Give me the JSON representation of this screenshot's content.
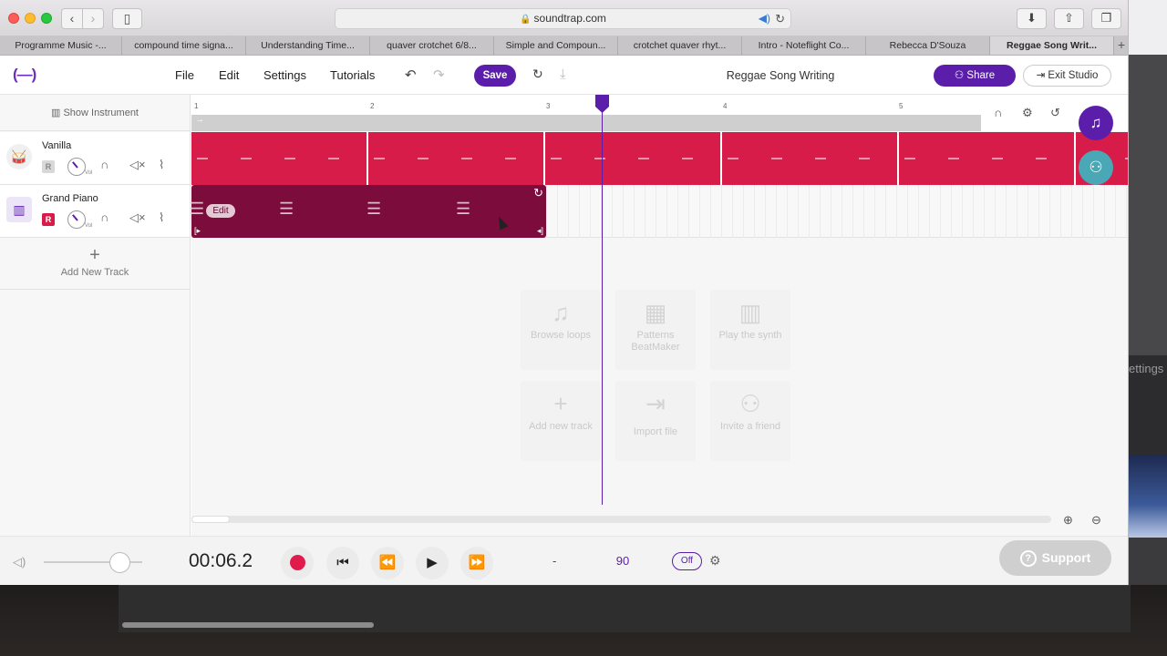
{
  "browser": {
    "address": "soundtrap.com",
    "tabs": [
      {
        "label": "Programme Music -...",
        "width": 134
      },
      {
        "label": "compound time signa...",
        "width": 136
      },
      {
        "label": "Understanding Time...",
        "width": 136
      },
      {
        "label": "quaver crotchet 6/8...",
        "width": 136
      },
      {
        "label": "Simple and Compoun...",
        "width": 136
      },
      {
        "label": "crotchet quaver rhyt...",
        "width": 136
      },
      {
        "label": "Intro - Noteflight Co...",
        "width": 136
      },
      {
        "label": "Rebecca D'Souza",
        "width": 136
      },
      {
        "label": "Reggae Song Writ...",
        "width": 136,
        "active": true
      }
    ]
  },
  "appbar": {
    "logo": "(—)",
    "menu": {
      "file": "File",
      "edit": "Edit",
      "settings": "Settings",
      "tutorials": "Tutorials"
    },
    "save": "Save",
    "project_title": "Reggae Song Writing",
    "share": "Share",
    "exit": "Exit Studio"
  },
  "left": {
    "show_instrument": "Show Instrument",
    "tracks": [
      {
        "name": "Vanilla",
        "rec": "R",
        "vol": "Vol"
      },
      {
        "name": "Grand Piano",
        "rec": "R",
        "vol": "Vol"
      }
    ],
    "add_track": "Add New Track"
  },
  "ruler": {
    "marks": [
      "1",
      "2",
      "3",
      "4",
      "5"
    ]
  },
  "region": {
    "edit": "Edit"
  },
  "empty_cards": [
    {
      "icon": "♫",
      "label": "Browse loops"
    },
    {
      "icon": "▦",
      "label": "Patterns BeatMaker"
    },
    {
      "icon": "▥",
      "label": "Play the synth"
    },
    {
      "icon": "+",
      "label": "Add new track"
    },
    {
      "icon": "⇥",
      "label": "Import file"
    },
    {
      "icon": "⚇",
      "label": "Invite a friend"
    }
  ],
  "transport": {
    "time": "00:06.2",
    "key": "-",
    "bpm": "90",
    "metronome": "Off"
  },
  "support": "Support",
  "desktop": {
    "side_text": "ettings"
  }
}
